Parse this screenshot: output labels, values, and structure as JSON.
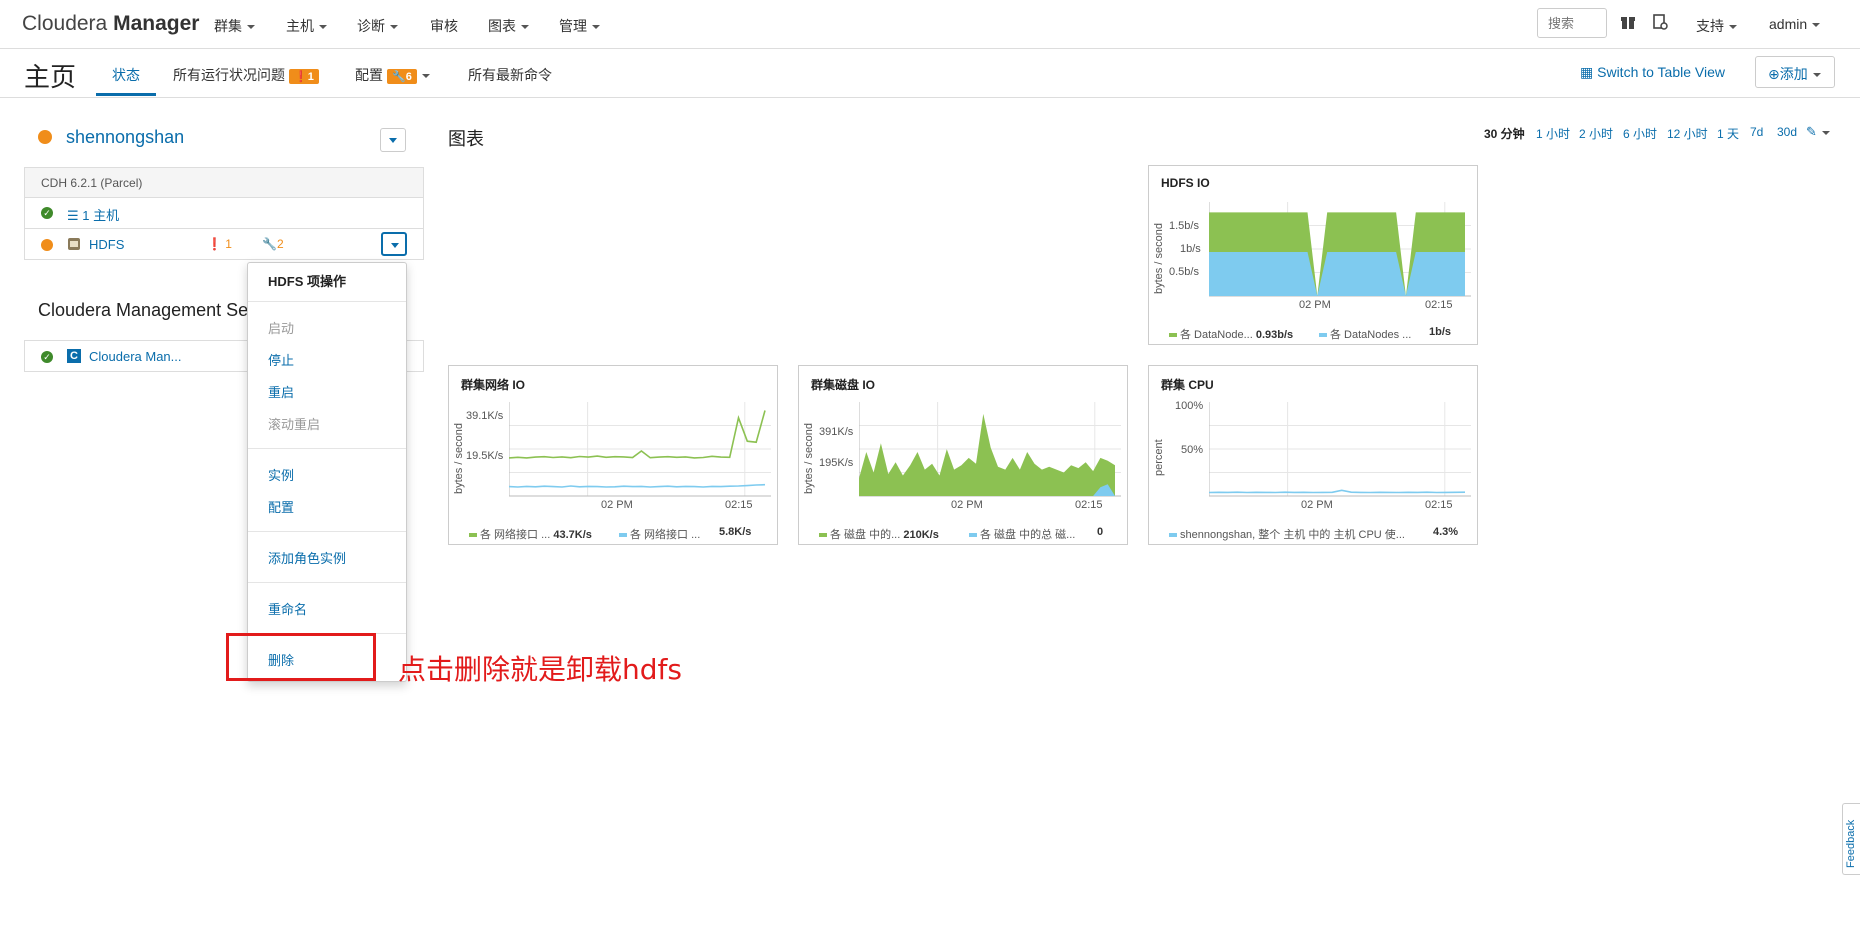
{
  "nav": {
    "brand_light": "Cloudera",
    "brand_bold": "Manager",
    "items": [
      "群集",
      "主机",
      "诊断",
      "审核",
      "图表",
      "管理"
    ],
    "search_placeholder": "搜索",
    "support": "支持",
    "user": "admin"
  },
  "header": {
    "title": "主页",
    "tabs": [
      {
        "label": "状态"
      },
      {
        "label": "所有运行状况问题",
        "badge": "1"
      },
      {
        "label": "配置",
        "badge": "6"
      },
      {
        "label": "所有最新命令"
      }
    ],
    "switch_view": "Switch to Table View",
    "add_button": "添加"
  },
  "cluster": {
    "name": "shennongshan",
    "version": "CDH 6.2.1 (Parcel)",
    "hosts": "1 主机",
    "service_name": "HDFS",
    "service_alerts": "1",
    "service_config": "2"
  },
  "cms": {
    "title": "Cloudera Management Ser",
    "service": "Cloudera Man..."
  },
  "menu": {
    "title": "HDFS 项操作",
    "items": [
      {
        "label": "启动",
        "disabled": true
      },
      {
        "label": "停止",
        "disabled": false
      },
      {
        "label": "重启",
        "disabled": false
      },
      {
        "label": "滚动重启",
        "disabled": true
      },
      {
        "label": "实例",
        "disabled": false
      },
      {
        "label": "配置",
        "disabled": false
      },
      {
        "label": "添加角色实例",
        "disabled": false
      },
      {
        "label": "重命名",
        "disabled": false
      },
      {
        "label": "删除",
        "disabled": false
      }
    ]
  },
  "annotation": "点击删除就是卸载hdfs",
  "charts_section": {
    "title": "图表",
    "ranges": [
      "30 分钟",
      "1 小时",
      "2 小时",
      "6 小时",
      "12 小时",
      "1 天",
      "7d",
      "30d"
    ],
    "active_range": "30 分钟"
  },
  "colors": {
    "green": "#8cc152",
    "blue": "#7ecbef",
    "accent": "#0a6dab",
    "orange": "#f08d1a",
    "red": "#e21b1b"
  },
  "chart_data": [
    {
      "type": "area",
      "title": "HDFS IO",
      "ylabel": "bytes / second",
      "ytick_labels": [
        "0.5b/s",
        "1b/s",
        "1.5b/s"
      ],
      "xtick_labels": [
        "02 PM",
        "02:15"
      ],
      "series": [
        {
          "name": "各 DataNode...",
          "value_label": "0.93b/s",
          "color": "#8cc152",
          "values": [
            1.9,
            1.9,
            1.9,
            1.9,
            1.9,
            1.9,
            1.9,
            1.9,
            1.9,
            1.9,
            1.9,
            0,
            1.9,
            1.9,
            1.9,
            1.9,
            1.9,
            1.9,
            1.9,
            1.9,
            0,
            1.9,
            1.9,
            1.9,
            1.9,
            1.9,
            1.9
          ]
        },
        {
          "name": "各 DataNodes ...",
          "value_label": "1b/s",
          "color": "#7ecbef",
          "values": [
            1,
            1,
            1,
            1,
            1,
            1,
            1,
            1,
            1,
            1,
            1,
            0,
            1,
            1,
            1,
            1,
            1,
            1,
            1,
            1,
            0,
            1,
            1,
            1,
            1,
            1,
            1
          ]
        }
      ],
      "ylim": [
        0,
        2
      ]
    },
    {
      "type": "line",
      "title": "群集网络 IO",
      "ylabel": "bytes / second",
      "ytick_labels": [
        "19.5K/s",
        "39.1K/s"
      ],
      "xtick_labels": [
        "02 PM",
        "02:15"
      ],
      "series": [
        {
          "name": "各 网络接口 ...",
          "value_label": "43.7K/s",
          "color": "#8cc152",
          "values": [
            19.5,
            19.8,
            19.5,
            19.9,
            20.1,
            19.7,
            20.0,
            19.6,
            20.2,
            19.9,
            20.4,
            19.8,
            20.1,
            20.0,
            19.7,
            23.0,
            19.6,
            19.9,
            20.1,
            19.8,
            20.0,
            19.5,
            19.7,
            20.3,
            19.9,
            19.8,
            40.0,
            28.0,
            27.5,
            43.7
          ]
        },
        {
          "name": "各 网络接口 ...",
          "value_label": "5.8K/s",
          "color": "#7ecbef",
          "values": [
            4.8,
            4.6,
            4.9,
            4.7,
            5.0,
            4.8,
            4.6,
            5.1,
            4.7,
            4.9,
            4.8,
            4.6,
            4.7,
            5.0,
            4.8,
            4.9,
            4.6,
            4.8,
            5.0,
            4.7,
            4.9,
            4.8,
            4.6,
            4.9,
            4.8,
            5.0,
            5.1,
            5.3,
            5.6,
            5.8
          ]
        }
      ],
      "ylim": [
        0,
        45
      ]
    },
    {
      "type": "area",
      "title": "群集磁盘 IO",
      "ylabel": "bytes / second",
      "ytick_labels": [
        "195K/s",
        "391K/s"
      ],
      "xtick_labels": [
        "02 PM",
        "02:15"
      ],
      "series": [
        {
          "name": "各 磁盘 中的...",
          "value_label": "210K/s",
          "color": "#8cc152",
          "values": [
            120,
            300,
            160,
            360,
            150,
            230,
            140,
            210,
            300,
            180,
            220,
            140,
            320,
            180,
            210,
            260,
            220,
            560,
            330,
            200,
            180,
            260,
            180,
            300,
            220,
            180,
            200,
            180,
            160,
            210,
            190,
            230,
            170,
            260,
            240,
            210
          ]
        },
        {
          "name": "各 磁盘 中的总 磁...",
          "value_label": "0",
          "color": "#7ecbef",
          "values": [
            0,
            0,
            0,
            0,
            0,
            0,
            0,
            0,
            0,
            0,
            0,
            0,
            0,
            0,
            0,
            0,
            0,
            0,
            0,
            0,
            0,
            0,
            0,
            0,
            0,
            0,
            0,
            0,
            0,
            0,
            0,
            0,
            0,
            60,
            80,
            0
          ]
        }
      ],
      "ylim": [
        0,
        600
      ]
    },
    {
      "type": "line",
      "title": "群集 CPU",
      "ylabel": "percent",
      "ytick_labels": [
        "50%",
        "100%"
      ],
      "xtick_labels": [
        "02 PM",
        "02:15"
      ],
      "series": [
        {
          "name": "shennongshan, 整个 主机 中的 主机 CPU 使...",
          "value_label": "4.3%",
          "color": "#7ecbef",
          "values": [
            4.0,
            4.2,
            4.1,
            4.3,
            4.0,
            4.2,
            4.1,
            4.0,
            4.3,
            4.1,
            4.2,
            4.0,
            4.1,
            4.2,
            6.5,
            4.3,
            4.1,
            4.0,
            4.2,
            4.1,
            4.0,
            4.2,
            4.1,
            4.3,
            4.0,
            4.1,
            4.2,
            4.3
          ]
        }
      ],
      "ylim": [
        0,
        100
      ]
    }
  ],
  "feedback": "Feedback"
}
